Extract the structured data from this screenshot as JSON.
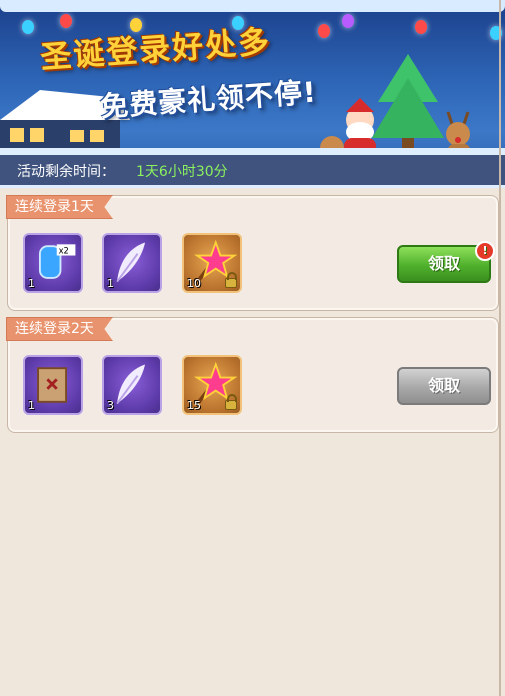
{
  "banner": {
    "title": "圣诞登录好处多",
    "subtitle": "免费豪礼领不停!"
  },
  "timer": {
    "label": "活动剩余时间：",
    "value": "1天6小时30分"
  },
  "days": [
    {
      "label": "连续登录1天",
      "items": [
        {
          "icon": "potion-x2-icon",
          "count": "1",
          "frame": "purple",
          "locked": false
        },
        {
          "icon": "feather-icon",
          "count": "1",
          "frame": "purple",
          "locked": false
        },
        {
          "icon": "star-wand-icon",
          "count": "10",
          "frame": "gold",
          "locked": true
        }
      ],
      "button": {
        "label": "领取",
        "state": "active",
        "badge": "!"
      }
    },
    {
      "label": "连续登录2天",
      "items": [
        {
          "icon": "scroll-map-icon",
          "count": "1",
          "frame": "purple",
          "locked": false
        },
        {
          "icon": "feather-icon",
          "count": "3",
          "frame": "purple",
          "locked": false
        },
        {
          "icon": "star-wand-icon",
          "count": "15",
          "frame": "gold",
          "locked": true
        }
      ],
      "button": {
        "label": "领取",
        "state": "disabled"
      }
    }
  ],
  "colors": {
    "accent_green": "#4fb02c",
    "timer_value": "#8cf25e",
    "ribbon": "#e9936e",
    "panel_bg": "#f3ebe3"
  }
}
